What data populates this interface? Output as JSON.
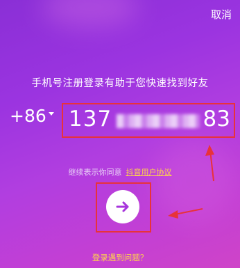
{
  "header": {
    "cancel_label": "取消"
  },
  "main": {
    "headline": "手机号注册登录有助于您快速找到好友",
    "country_code": "+86",
    "phone_prefix": "137",
    "phone_suffix": "83",
    "agreement_text": "继续表示你同意",
    "agreement_link": "抖音用户协议"
  },
  "footer": {
    "help_link": "登录遇到问题？"
  },
  "icons": {
    "submit": "arrow-right-icon",
    "country_dropdown": "caret-down-icon"
  },
  "colors": {
    "annotation": "#e8323a",
    "link": "#ffd44a",
    "button_icon": "#a736dc"
  }
}
